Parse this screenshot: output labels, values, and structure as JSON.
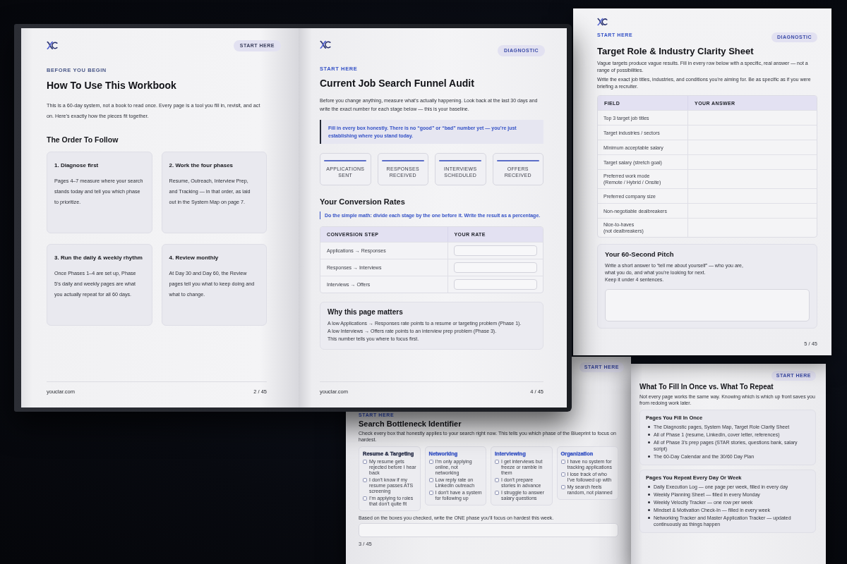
{
  "book": {
    "left_page": {
      "tag": "START HERE",
      "eyebrow": "BEFORE YOU BEGIN",
      "title": "How To Use This Workbook",
      "intro": "This is a 60-day system, not a book to read once. Every page is a tool you fill in, revisit, and act on. Here’s exactly how the pieces fit together.",
      "section_title": "The Order To Follow",
      "steps": [
        {
          "title": "1. Diagnose first",
          "text": "Pages 4–7 measure where your search stands today and tell you which phase to prioritize."
        },
        {
          "title": "2. Work the four phases",
          "text": "Resume, Outreach, Interview Prep, and Tracking — in that order, as laid out in the System Map on page 7."
        },
        {
          "title": "3. Run the daily & weekly rhythm",
          "text": "Once Phases 1–4 are set up, Phase 5’s daily and weekly pages are what you actually repeat for all 60 days."
        },
        {
          "title": "4. Review monthly",
          "text": "At Day 30 and Day 60, the Review pages tell you what to keep doing and what to change."
        }
      ],
      "footer": {
        "site": "youclar.com",
        "page": "2 / 45"
      }
    },
    "right_page": {
      "tag": "DIAGNOSTIC",
      "eyebrow": "START HERE",
      "title": "Current Job Search Funnel Audit",
      "intro": "Before you change anything, measure what’s actually happening. Look back at the last 30 days and write the exact number for each stage below — this is your baseline.",
      "callout": "Fill in every box honestly. There is no “good” or “bad” number yet — you’re just establishing where you stand today.",
      "stages": [
        "APPLICATIONS\nSENT",
        "RESPONSES\nRECEIVED",
        "INTERVIEWS\nSCHEDULED",
        "OFFERS\nRECEIVED"
      ],
      "section_title": "Your Conversion Rates",
      "note": "Do the simple math: divide each stage by the one before it. Write the result as a percentage.",
      "table": {
        "columns": [
          "CONVERSION STEP",
          "YOUR RATE"
        ],
        "rows": [
          "Applications → Responses",
          "Responses → Interviews",
          "Interviews → Offers"
        ]
      },
      "why": {
        "title": "Why this page matters",
        "lines": [
          "A low Applications → Responses rate points to a resume or targeting problem (Phase 1).",
          "A low Interviews → Offers rate points to an interview prep problem (Phase 3).",
          "This number tells you where to focus first."
        ]
      },
      "footer": {
        "site": "youclar.com",
        "page": "4 / 45"
      }
    }
  },
  "clarity_sheet": {
    "eyebrow": "START HERE",
    "tag": "DIAGNOSTIC",
    "title": "Target Role & Industry Clarity Sheet",
    "intro": [
      "Vague targets produce vague results. Fill in every row below with a specific, real answer — not a range of possibilities.",
      "Write the exact job titles, industries, and conditions you’re aiming for. Be as specific as if you were briefing a recruiter."
    ],
    "table": {
      "columns": [
        "FIELD",
        "YOUR ANSWER"
      ],
      "rows": [
        "Top 3 target job titles",
        "Target industries / sectors",
        "Minimum acceptable salary",
        "Target salary (stretch goal)",
        "Preferred work mode\n(Remote / Hybrid / Onsite)",
        "Preferred company size",
        "Non-negotiable dealbreakers",
        "Nice-to-haves\n(not dealbreakers)"
      ]
    },
    "pitch": {
      "title": "Your 60-Second Pitch",
      "text": "Write a short answer to “tell me about yourself” — who you are,\nwhat you do, and what you’re looking for next.\nKeep it under 4 sentences."
    },
    "page": "5 / 45"
  },
  "bottleneck_sheet": {
    "tag": "START HERE",
    "eyebrow": "START HERE",
    "title": "Search Bottleneck Identifier",
    "intro": "Check every box that honestly applies to your search right now. This tells you which phase of the Blueprint to focus on hardest.",
    "categories": [
      {
        "title": "Resume & Targeting",
        "color": "#1e2540",
        "items": [
          {
            "text": "My resume gets rejected before I hear back",
            "checked": false
          },
          {
            "text": "I don’t know if my resume passes ATS screening",
            "checked": false
          },
          {
            "text": "I’m applying to roles that don’t quite fit",
            "checked": false
          }
        ]
      },
      {
        "title": "Networking",
        "color": "#3552c4",
        "items": [
          {
            "text": "I’m only applying online, not networking",
            "checked": false
          },
          {
            "text": "Low reply rate on LinkedIn outreach",
            "checked": false
          },
          {
            "text": "I don’t have a system for following up",
            "checked": false
          }
        ]
      },
      {
        "title": "Interviewing",
        "color": "#3552c4",
        "items": [
          {
            "text": "I get interviews but freeze or ramble in them",
            "checked": false
          },
          {
            "text": "I don’t prepare stories in advance",
            "checked": false
          },
          {
            "text": "I struggle to answer salary questions",
            "checked": false
          }
        ]
      },
      {
        "title": "Organization",
        "color": "#3552c4",
        "items": [
          {
            "text": "I have no system for tracking applications",
            "checked": false
          },
          {
            "text": "I lose track of who I’ve followed up with",
            "checked": false
          },
          {
            "text": "My search feels random, not planned",
            "checked": false
          }
        ]
      }
    ],
    "prompt": "Based on the boxes you checked, write the ONE phase you’ll focus on hardest this week.",
    "page": "3 / 45"
  },
  "fill_sheet": {
    "tag": "START HERE",
    "title": "What To Fill In Once vs. What To Repeat",
    "intro": "Not every page works the same way. Knowing which is which up front saves you from redoing work later.",
    "groups": [
      {
        "title": "Pages You Fill In Once",
        "items": [
          "The Diagnostic pages, System Map, Target Role Clarity Sheet",
          "All of Phase 1 (resume, LinkedIn, cover letter, references)",
          "All of Phase 3’s prep pages (STAR stories, questions bank, salary script)",
          "The 60-Day Calendar and the 30/60 Day Plan"
        ]
      },
      {
        "title": "Pages You Repeat Every Day Or Week",
        "items": [
          "Daily Execution Log — one page per week, filled in every day",
          "Weekly Planning Sheet — filled in every Monday",
          "Weekly Velocity Tracker — one row per week",
          "Mindset & Motivation Check-In — filled in every week",
          "Networking Tracker and Master Application Tracker — updated continuously as things happen"
        ]
      }
    ]
  }
}
